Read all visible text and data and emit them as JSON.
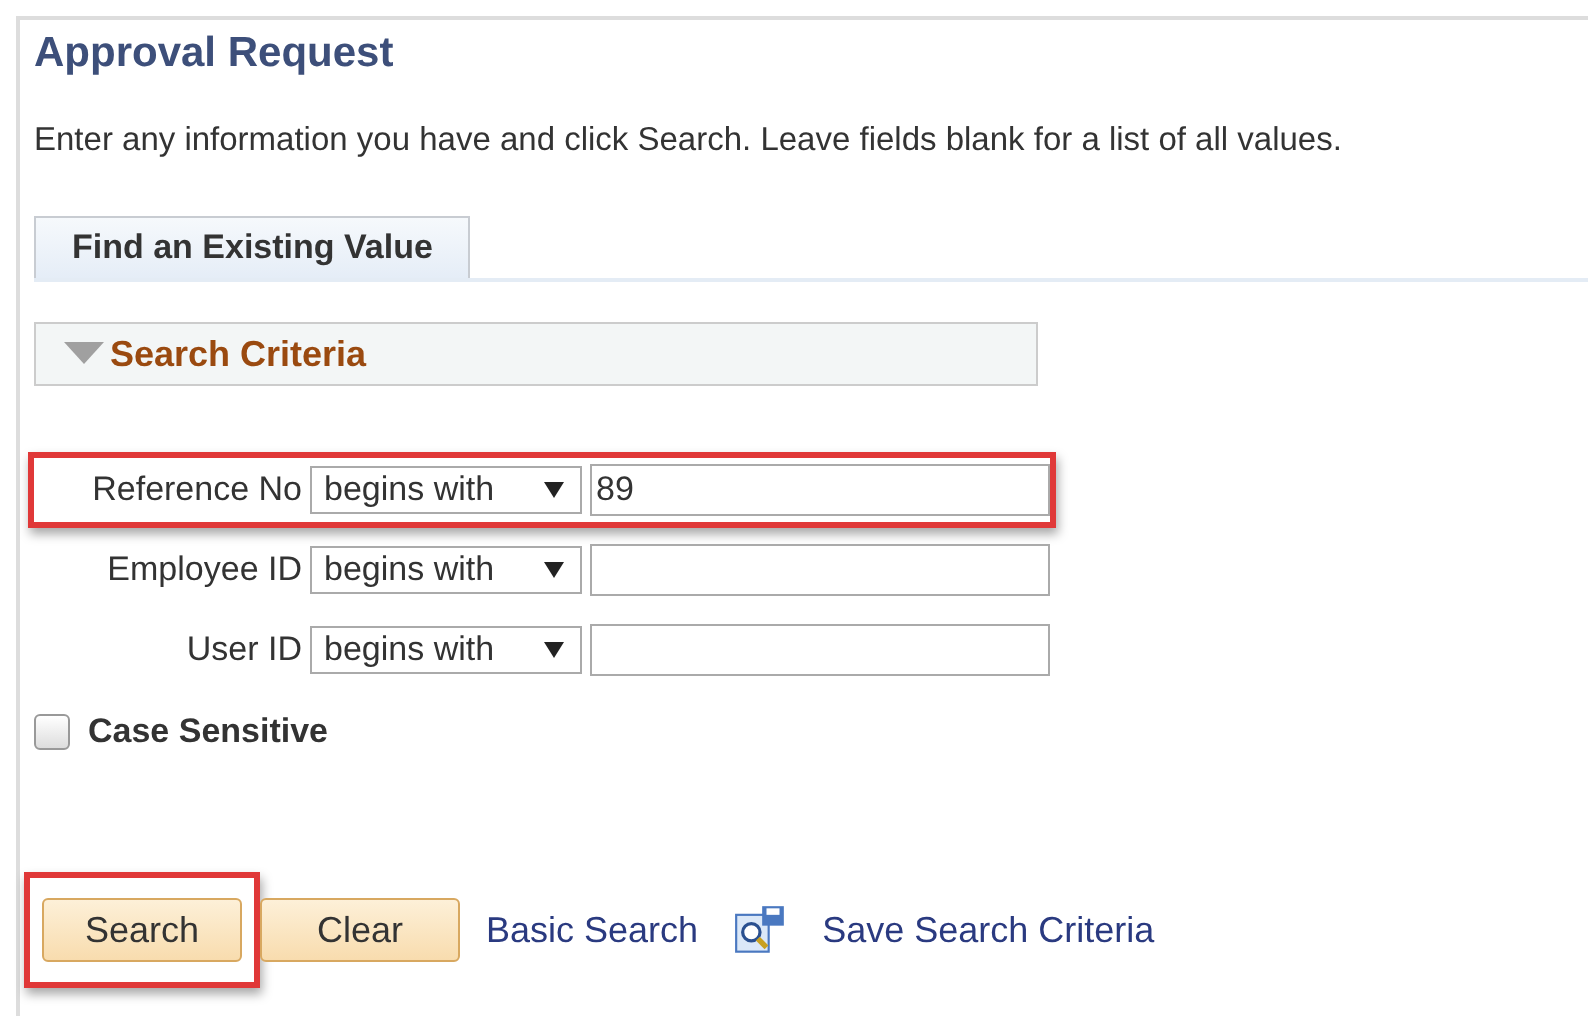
{
  "page": {
    "title": "Approval Request",
    "instructions": "Enter any information you have and click Search. Leave fields blank for a list of all values."
  },
  "tabs": [
    {
      "label": "Find an Existing Value",
      "selected": true
    }
  ],
  "section": {
    "title": "Search Criteria",
    "expanded": true
  },
  "fields": [
    {
      "label": "Reference No",
      "operator": "begins with",
      "value": "89",
      "highlighted": true
    },
    {
      "label": "Employee ID",
      "operator": "begins with",
      "highlighted": false
    },
    {
      "label": "User ID",
      "operator": "begins with",
      "highlighted": false
    }
  ],
  "case_sensitive": {
    "label": "Case Sensitive",
    "checked": false
  },
  "buttons": [
    {
      "label": "Search",
      "highlighted": true
    },
    {
      "label": "Clear",
      "highlighted": false
    }
  ],
  "links": [
    {
      "label": "Basic Search",
      "kind": "plain"
    },
    {
      "label": "Save Search Criteria",
      "kind": "save"
    }
  ]
}
